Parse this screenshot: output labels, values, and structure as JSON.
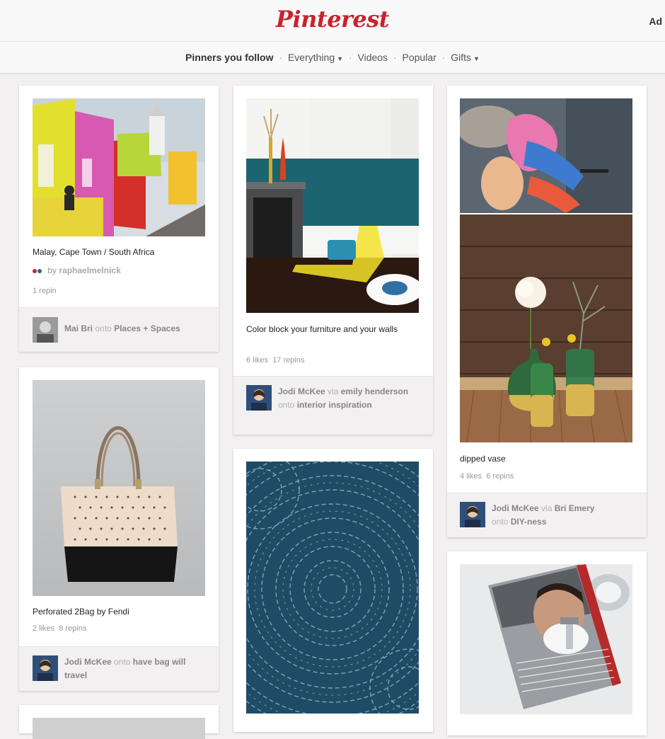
{
  "header": {
    "logo": "Pinterest",
    "right_text": "Ad"
  },
  "nav": {
    "active": "Pinners you follow",
    "items": [
      "Everything",
      "Videos",
      "Popular",
      "Gifts"
    ],
    "sep": "·"
  },
  "pins": {
    "cape_town": {
      "description": "Malay, Cape Town / South Africa",
      "by_label": "by",
      "pinner": "raphaelmelnick",
      "repins": "1 repin",
      "attribution": {
        "user": "Mai Bri",
        "verb": "onto",
        "board": "Places + Spaces"
      }
    },
    "color_block": {
      "description": "Color block your furniture and your walls",
      "likes": "6 likes",
      "repins": "17 repins",
      "attribution": {
        "user": "Jodi McKee",
        "via": "via",
        "via_user": "emily henderson",
        "verb": "onto",
        "board": "interior inspiration"
      }
    },
    "dipped_vase": {
      "description": "dipped vase",
      "likes": "4 likes",
      "repins": "6 repins",
      "attribution": {
        "user": "Jodi McKee",
        "via": "via",
        "via_user": "Bri Emery",
        "verb": "onto",
        "board": "DIY-ness"
      }
    },
    "fendi_bag": {
      "description": "Perforated 2Bag by Fendi",
      "likes": "2 likes",
      "repins": "8 repins",
      "attribution": {
        "user": "Jodi McKee",
        "verb": "onto",
        "board": "have bag will travel"
      }
    }
  },
  "colors": {
    "brand": "#c8232c",
    "background": "#f2f0f0",
    "pattern_blue": "#1f4b66"
  }
}
